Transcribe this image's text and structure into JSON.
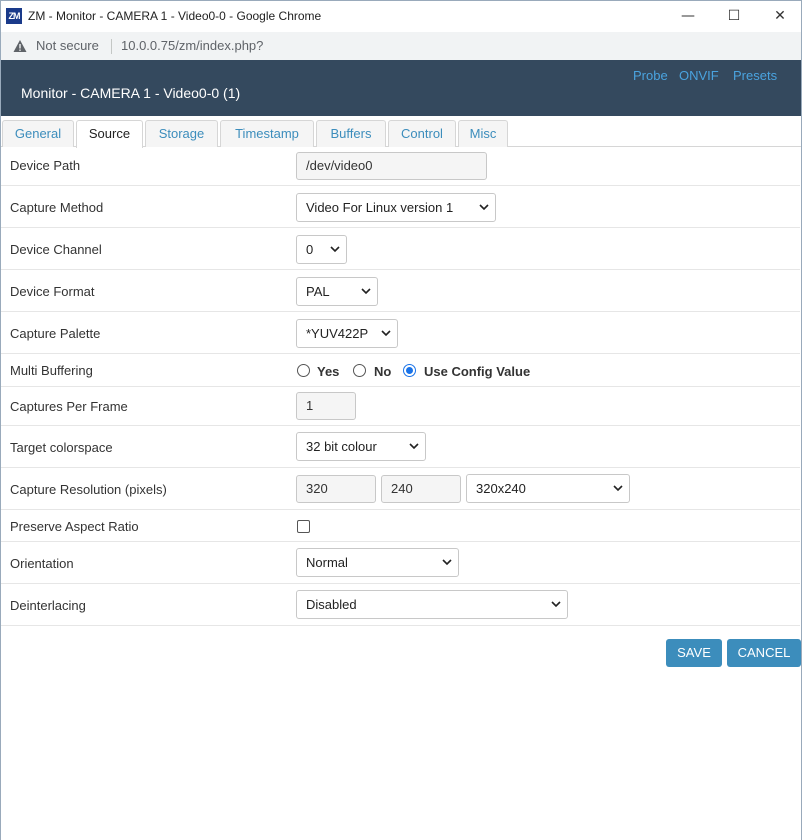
{
  "window": {
    "title": "ZM - Monitor - CAMERA 1 - Video0-0 - Google Chrome",
    "logo_text": "ZM",
    "minimize": "—",
    "maximize": "☐",
    "close": "✕"
  },
  "address": {
    "security": "Not secure",
    "url": "10.0.0.75/zm/index.php?"
  },
  "header": {
    "title": "Monitor - CAMERA 1 - Video0-0 (1)",
    "links": [
      "Probe",
      "ONVIF",
      "Presets"
    ]
  },
  "tabs": [
    {
      "label": "General"
    },
    {
      "label": "Source"
    },
    {
      "label": "Storage"
    },
    {
      "label": "Timestamp"
    },
    {
      "label": "Buffers"
    },
    {
      "label": "Control"
    },
    {
      "label": "Misc"
    }
  ],
  "active_tab": "Source",
  "form": {
    "device_path": {
      "label": "Device Path",
      "value": "/dev/video0"
    },
    "capture_method": {
      "label": "Capture Method",
      "value": "Video For Linux version 1"
    },
    "device_channel": {
      "label": "Device Channel",
      "value": "0"
    },
    "device_format": {
      "label": "Device Format",
      "value": "PAL"
    },
    "capture_palette": {
      "label": "Capture Palette",
      "value": "*YUV422P"
    },
    "multi_buffering": {
      "label": "Multi Buffering",
      "options": [
        "Yes",
        "No",
        "Use Config Value"
      ],
      "selected": "Use Config Value"
    },
    "captures_per_frame": {
      "label": "Captures Per Frame",
      "value": "1"
    },
    "target_colorspace": {
      "label": "Target colorspace",
      "value": "32 bit colour"
    },
    "capture_resolution": {
      "label": "Capture Resolution (pixels)",
      "width": "320",
      "height": "240",
      "preset": "320x240"
    },
    "preserve_aspect_ratio": {
      "label": "Preserve Aspect Ratio",
      "checked": false
    },
    "orientation": {
      "label": "Orientation",
      "value": "Normal"
    },
    "deinterlacing": {
      "label": "Deinterlacing",
      "value": "Disabled"
    }
  },
  "buttons": {
    "save": "SAVE",
    "cancel": "CANCEL"
  },
  "colors": {
    "header_bg": "#34495e",
    "link": "#4aa3df",
    "button_bg": "#3c8dbc",
    "radio_checked": "#1a73e8"
  }
}
